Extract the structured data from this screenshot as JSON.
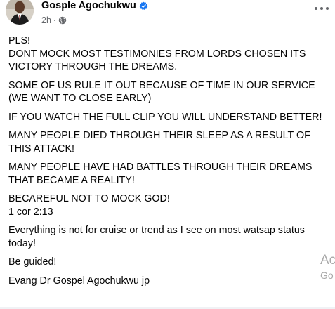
{
  "post": {
    "author": "Gosple Agochukwu",
    "timestamp": "2h",
    "separator": "·",
    "paragraphs": [
      "PLS!\nDONT MOCK MOST TESTIMONIES FROM LORDS CHOSEN ITS VICTORY THROUGH THE DREAMS.",
      "SOME OF US RULE IT OUT BECAUSE OF TIME IN OUR SERVICE (WE WANT TO CLOSE EARLY)",
      "IF YOU WATCH THE FULL CLIP YOU WILL UNDERSTAND BETTER!",
      " MANY PEOPLE DIED THROUGH THEIR SLEEP AS A RESULT OF THIS ATTACK!",
      "MANY PEOPLE HAVE HAD BATTLES THROUGH THEIR DREAMS THAT BECAME A REALITY!",
      "BECAREFUL NOT TO MOCK GOD!\n1 cor 2:13",
      "Everything is not for cruise or trend as I see on most watsap status today!",
      "Be guided!",
      "Evang Dr Gospel Agochukwu jp"
    ]
  },
  "watermark": {
    "line1": "Ac",
    "line2": "Go"
  },
  "colors": {
    "text": "#050505",
    "secondary": "#65676b",
    "verified": "#1877f2",
    "watermark": "#a9a9a9"
  },
  "icons": {
    "verified": "verified-badge-icon",
    "audience": "globe-icon",
    "more": "more-options-icon"
  }
}
